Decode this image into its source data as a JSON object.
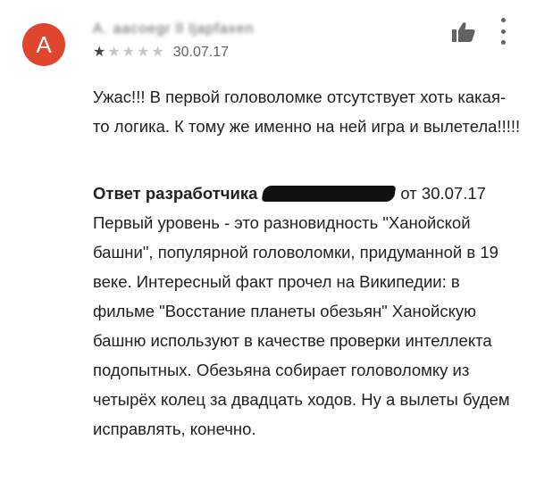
{
  "review": {
    "avatar_letter": "A",
    "author_name": "A. aacoegr ll ljapfaxen",
    "rating": 1,
    "max_rating": 5,
    "date": "30.07.17",
    "icons": {
      "helpful": "thumb-up-icon",
      "menu": "more-vert-icon"
    },
    "text": "Ужас!!! В первой головоломке отсутствует хоть какая-то логика. К тому же именно на ней игра и вылетела!!!!!"
  },
  "reply": {
    "title": "Ответ разработчика",
    "from_label": "от 30.07.17",
    "text": "Первый уровень - это разновидность \"Ханойской башни\", популярной головоломки, придуманной в 19 веке. Интересный факт прочел на Википедии: в фильме \"Восстание планеты обезьян\" Ханойскую башню используют в качестве проверки интеллекта подопытных. Обезьяна собирает головоломку из четырёх колец за двадцать ходов. Ну а вылеты будем исправлять, конечно."
  },
  "colors": {
    "avatar_bg": "#e0452e",
    "star_on": "#424242",
    "star_off": "#c7c7c7"
  }
}
